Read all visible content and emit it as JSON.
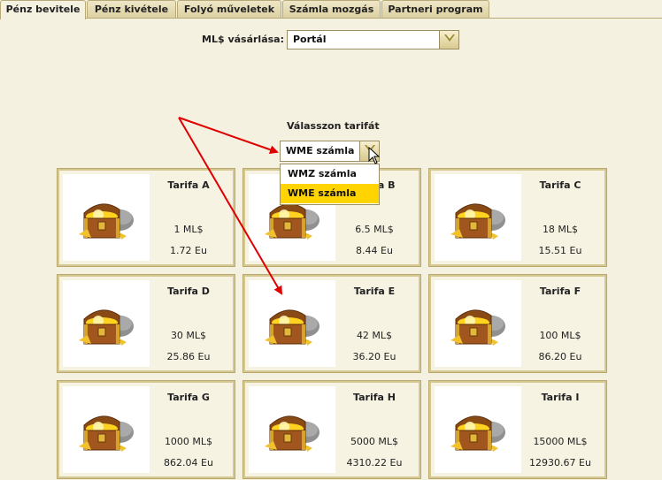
{
  "tabs": [
    {
      "label": "Pénz bevitele",
      "active": true
    },
    {
      "label": "Pénz kivétele",
      "active": false
    },
    {
      "label": "Folyó műveletek",
      "active": false
    },
    {
      "label": "Számla mozgás",
      "active": false
    },
    {
      "label": "Partneri program",
      "active": false
    }
  ],
  "purchase": {
    "label": "ML$ vásárlása:",
    "value": "Portál"
  },
  "tariff_select": {
    "label": "Válasszon tarifát",
    "value": "WME számla",
    "options": [
      {
        "label": "WMZ számla"
      },
      {
        "label": "WME számla",
        "selected": true
      }
    ]
  },
  "colors": {
    "accent": "#ffd400",
    "annotation_arrow": "#e00000",
    "background": "#f5f1e1"
  },
  "icons": {
    "card": "treasure-chest-icon"
  },
  "tariffs": [
    {
      "name": "Tarifa A",
      "ml": "1 ML$",
      "eu": "1.72 Eu"
    },
    {
      "name": "Tarifa B",
      "ml": "6.5 ML$",
      "eu": "8.44 Eu"
    },
    {
      "name": "Tarifa C",
      "ml": "18 ML$",
      "eu": "15.51 Eu"
    },
    {
      "name": "Tarifa D",
      "ml": "30 ML$",
      "eu": "25.86 Eu"
    },
    {
      "name": "Tarifa E",
      "ml": "42 ML$",
      "eu": "36.20 Eu"
    },
    {
      "name": "Tarifa F",
      "ml": "100 ML$",
      "eu": "86.20 Eu"
    },
    {
      "name": "Tarifa G",
      "ml": "1000 ML$",
      "eu": "862.04 Eu"
    },
    {
      "name": "Tarifa H",
      "ml": "5000 ML$",
      "eu": "4310.22 Eu"
    },
    {
      "name": "Tarifa I",
      "ml": "15000 ML$",
      "eu": "12930.67 Eu"
    }
  ]
}
